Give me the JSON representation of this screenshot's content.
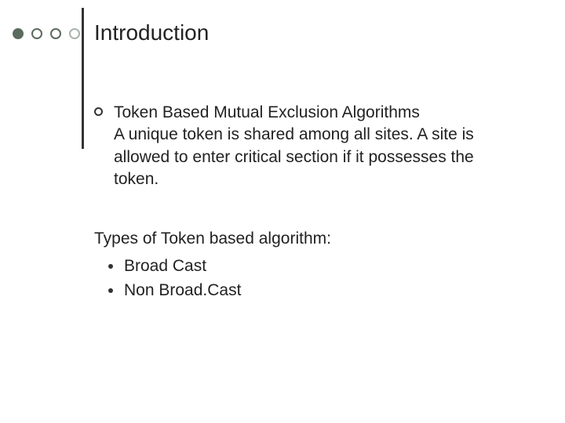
{
  "title": "Introduction",
  "main": {
    "heading": "Token Based Mutual Exclusion Algorithms",
    "description": " A unique token is shared among all sites. A site is allowed to enter critical section if it possesses the token."
  },
  "types": {
    "heading": "Types of Token based algorithm:",
    "items": [
      "Broad Cast",
      "Non Broad.Cast"
    ]
  }
}
